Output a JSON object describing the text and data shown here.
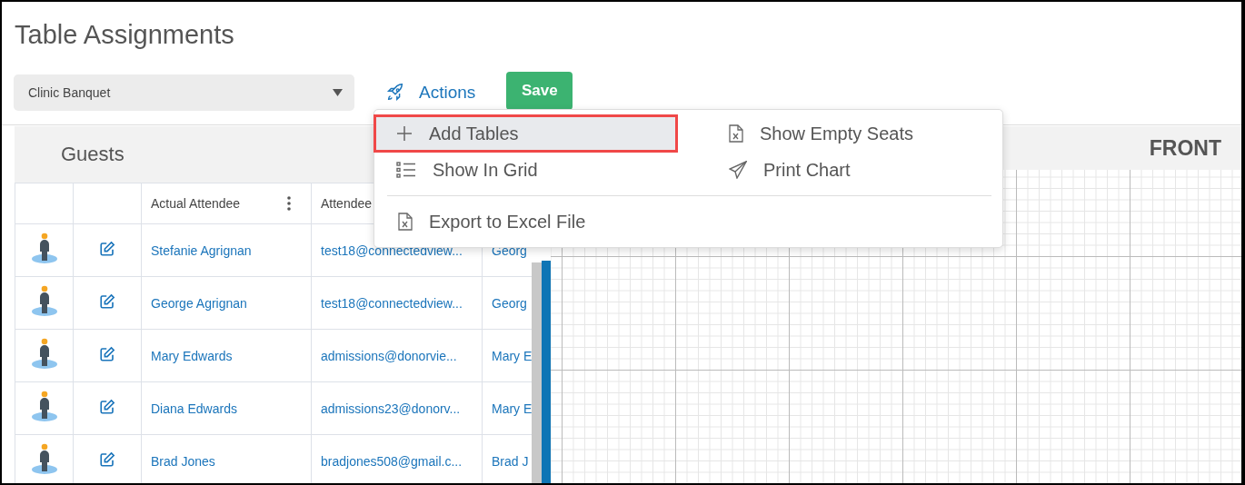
{
  "page": {
    "title": "Table Assignments"
  },
  "toolbar": {
    "event_select": "Clinic Banquet",
    "actions_label": "Actions",
    "save_label": "Save"
  },
  "actions_menu": {
    "items": [
      {
        "label": "Add Tables",
        "highlighted": true
      },
      {
        "label": "Show Empty Seats",
        "highlighted": false
      },
      {
        "label": "Show In Grid",
        "highlighted": false
      },
      {
        "label": "Print Chart",
        "highlighted": false
      }
    ],
    "footer_items": [
      {
        "label": "Export to Excel File",
        "highlighted": false
      }
    ]
  },
  "guests": {
    "title": "Guests",
    "columns": [
      "Actual Attendee",
      "Attendee"
    ],
    "rows": [
      {
        "name": "Stefanie Agrignan",
        "email": "test18@connectedview...",
        "column_3": "Georg"
      },
      {
        "name": "George Agrignan",
        "email": "test18@connectedview...",
        "column_3": "Georg"
      },
      {
        "name": "Mary Edwards",
        "email": "admissions@donorvie...",
        "column_3": "Mary E"
      },
      {
        "name": "Diana Edwards",
        "email": "admissions23@donorv...",
        "column_3": "Mary E"
      },
      {
        "name": "Brad Jones",
        "email": "bradjones508@gmail.c...",
        "column_3": "Brad J"
      }
    ]
  },
  "canvas": {
    "header": "FRONT"
  }
}
